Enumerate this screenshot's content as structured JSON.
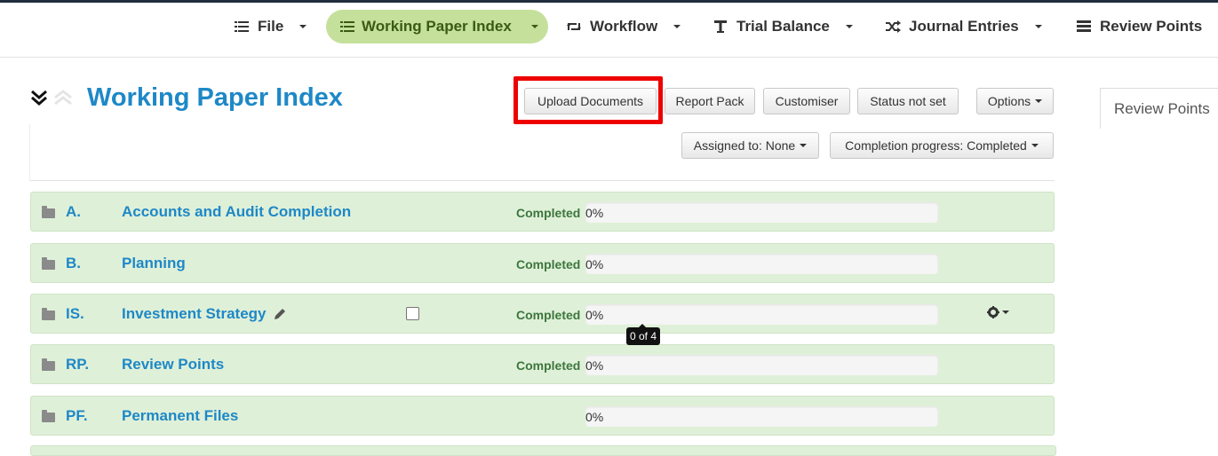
{
  "nav": {
    "items": [
      {
        "label": "File",
        "icon": "list-icon",
        "active": false
      },
      {
        "label": "Working Paper Index",
        "icon": "list-icon",
        "active": true
      },
      {
        "label": "Workflow",
        "icon": "retweet-icon",
        "active": false
      },
      {
        "label": "Trial Balance",
        "icon": "text-icon",
        "active": false
      },
      {
        "label": "Journal Entries",
        "icon": "shuffle-icon",
        "active": false
      },
      {
        "label": "Review Points",
        "icon": "tasks-icon",
        "active": false
      }
    ]
  },
  "header": {
    "title": "Working Paper Index",
    "buttons": {
      "upload": "Upload Documents",
      "report_pack": "Report Pack",
      "customiser": "Customiser",
      "status": "Status not set",
      "options": "Options",
      "assigned": "Assigned to: None",
      "completion": "Completion progress: Completed"
    }
  },
  "side_tab": {
    "label": "Review Points"
  },
  "rows": [
    {
      "code": "A.",
      "name": "Accounts and Audit Completion",
      "status": "Completed",
      "progress_text": "0%",
      "progress": 0
    },
    {
      "code": "B.",
      "name": "Planning",
      "status": "Completed",
      "progress_text": "0%",
      "progress": 0
    },
    {
      "code": "IS.",
      "name": "Investment Strategy",
      "status": "Completed",
      "progress_text": "0%",
      "progress": 0
    },
    {
      "code": "RP.",
      "name": "Review Points",
      "status": "Completed",
      "progress_text": "0%",
      "progress": 0
    },
    {
      "code": "PF.",
      "name": "Permanent Files",
      "status": "",
      "progress_text": "0%",
      "progress": 0
    }
  ],
  "tooltip": "0 of 4",
  "colors": {
    "accent": "#1e88c7",
    "active_nav": "#c5e09b",
    "row_bg": "#dff0d8",
    "status_green": "#3c763d",
    "highlight": "#ee0000"
  }
}
